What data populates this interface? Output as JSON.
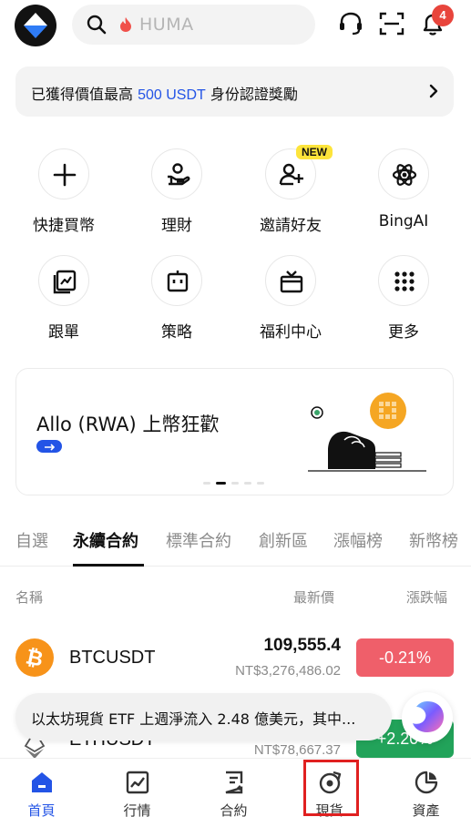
{
  "header": {
    "search_placeholder": "HUMA",
    "notification_count": "4"
  },
  "banner": {
    "text_pre": "已獲得價值最高 ",
    "text_highlight": "500 USDT",
    "text_post": " 身份認證獎勵"
  },
  "quick_actions": [
    {
      "label": "快捷買幣",
      "icon": "plus-icon"
    },
    {
      "label": "理財",
      "icon": "hand-coin-icon"
    },
    {
      "label": "邀請好友",
      "icon": "add-user-icon",
      "tag": "NEW"
    },
    {
      "label": "BingAI",
      "icon": "atom-icon"
    },
    {
      "label": "跟單",
      "icon": "copy-trade-icon"
    },
    {
      "label": "策略",
      "icon": "bot-icon"
    },
    {
      "label": "福利中心",
      "icon": "gift-icon"
    },
    {
      "label": "更多",
      "icon": "more-grid-icon"
    }
  ],
  "promo": {
    "title": "Allo (RWA) 上幣狂歡"
  },
  "market_tabs": [
    "自選",
    "永續合約",
    "標準合約",
    "創新區",
    "漲幅榜",
    "新幣榜"
  ],
  "active_tab": "永續合約",
  "columns": {
    "name": "名稱",
    "last_price": "最新價",
    "change": "漲跌幅"
  },
  "rows": [
    {
      "symbol": "BTCUSDT",
      "price": "109,555.4",
      "fiat": "NT$3,276,486.02",
      "change": "-0.21%",
      "change_color": "#ef5f6a"
    },
    {
      "symbol": "ETHUSDT",
      "price": "",
      "fiat": "NT$78,667.37",
      "change": "+2.20%",
      "change_color": "#22a35a"
    }
  ],
  "news_toast": {
    "text": "以太坊現貨 ETF 上週淨流入 2.48 億美元，其中..."
  },
  "bottom_nav": [
    {
      "label": "首頁",
      "icon": "home-icon",
      "active": true
    },
    {
      "label": "行情",
      "icon": "market-chart-icon",
      "active": false
    },
    {
      "label": "合約",
      "icon": "contract-icon",
      "active": false
    },
    {
      "label": "現貨",
      "icon": "spot-icon",
      "active": false
    },
    {
      "label": "資產",
      "icon": "assets-pie-icon",
      "active": false
    }
  ],
  "colors": {
    "accent": "#2354e6",
    "down": "#ef5f6a",
    "up": "#22a35a",
    "badge": "#e8453c",
    "new_tag": "#fde43b",
    "highlight_box": "#e02020"
  }
}
